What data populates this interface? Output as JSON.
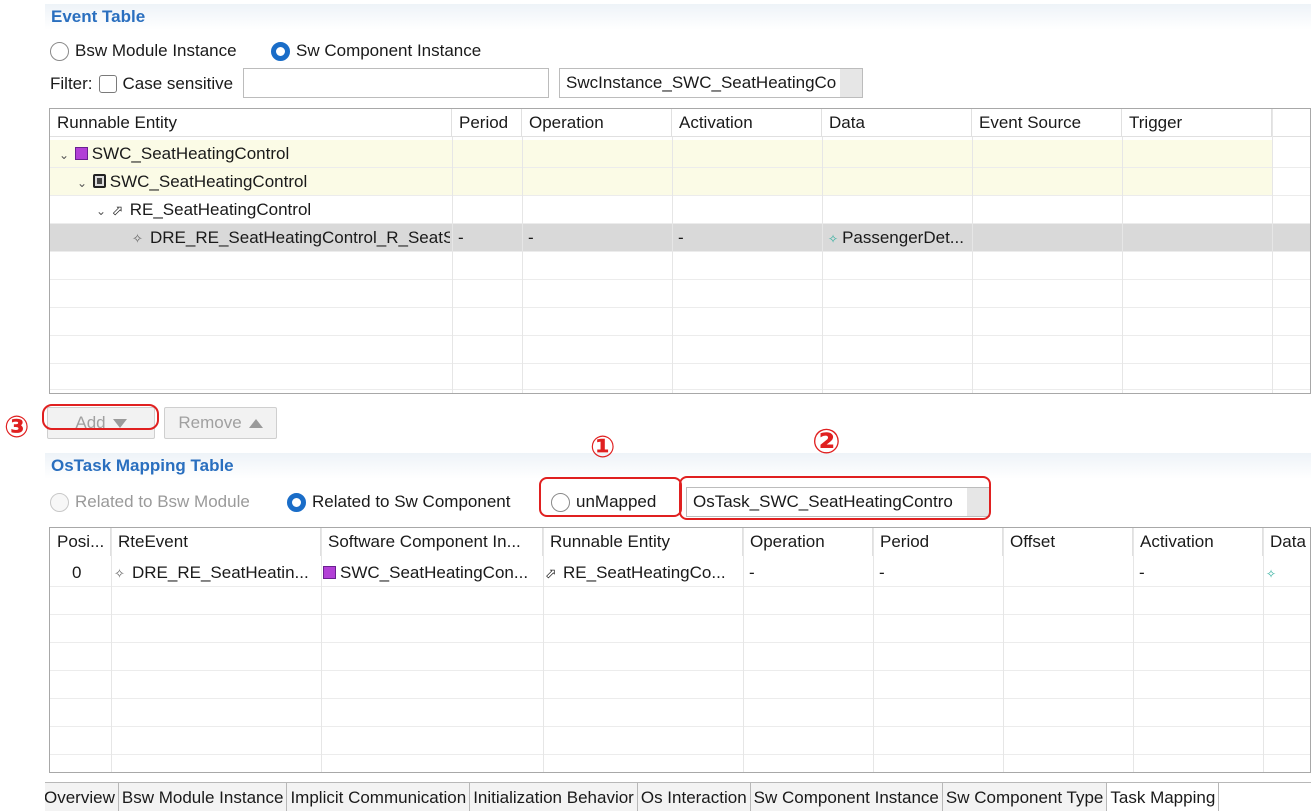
{
  "event_table": {
    "title": "Event Table",
    "radio_bsw_label": "Bsw Module Instance",
    "radio_swc_label": "Sw Component Instance",
    "filter_label": "Filter:",
    "case_sensitive_label": "Case sensitive",
    "filter_value": "",
    "instance_select_value": "SwcInstance_SWC_SeatHeatingCo",
    "columns": [
      "Runnable Entity",
      "Period",
      "Operation",
      "Activation",
      "Data",
      "Event Source",
      "Trigger"
    ],
    "rows": [
      {
        "entity": "SWC_SeatHeatingControl",
        "icon": "component-instance-icon",
        "period": "",
        "operation": "",
        "activation": "",
        "data": ""
      },
      {
        "entity": "SWC_SeatHeatingControl",
        "icon": "component-prototype-icon",
        "period": "",
        "operation": "",
        "activation": "",
        "data": ""
      },
      {
        "entity": "RE_SeatHeatingControl",
        "icon": "runnable-icon",
        "period": "",
        "operation": "",
        "activation": "",
        "data": ""
      },
      {
        "entity": "DRE_RE_SeatHeatingControl_R_SeatS",
        "icon": "event-icon",
        "period": "-",
        "operation": "-",
        "activation": "-",
        "data": "PassengerDet..."
      }
    ],
    "add_label": "Add",
    "remove_label": "Remove"
  },
  "ostask_table": {
    "title": "OsTask Mapping Table",
    "radio_bsw_label": "Related to Bsw Module",
    "radio_swc_label": "Related to Sw Component",
    "unmapped_label": "unMapped",
    "ostask_select_value": "OsTask_SWC_SeatHeatingContro",
    "columns": [
      "Posi...",
      "RteEvent",
      "Software Component In...",
      "Runnable Entity",
      "Operation",
      "Period",
      "Offset",
      "Activation",
      "Data"
    ],
    "rows": [
      {
        "position": "0",
        "rte_event": "DRE_RE_SeatHeatin...",
        "swc_instance": "SWC_SeatHeatingCon...",
        "runnable": "RE_SeatHeatingCo...",
        "operation": "-",
        "period": "-",
        "offset": "",
        "activation": "-",
        "data": ""
      }
    ]
  },
  "annotations": {
    "one": "①",
    "two": "②",
    "three": "③"
  },
  "bottom_tabs": [
    {
      "label": "Overview",
      "active": false
    },
    {
      "label": "Bsw Module Instance",
      "active": false
    },
    {
      "label": "Implicit Communication",
      "active": false
    },
    {
      "label": "Initialization Behavior",
      "active": false
    },
    {
      "label": "Os Interaction",
      "active": false
    },
    {
      "label": "Sw Component Instance",
      "active": false
    },
    {
      "label": "Sw Component Type",
      "active": false
    },
    {
      "label": "Task Mapping",
      "active": true
    }
  ],
  "colors": {
    "accent": "#2a6fbf",
    "annotation": "#e02020",
    "row_highlight": "#fbfbe6",
    "row_selected": "#d9d9d9"
  }
}
